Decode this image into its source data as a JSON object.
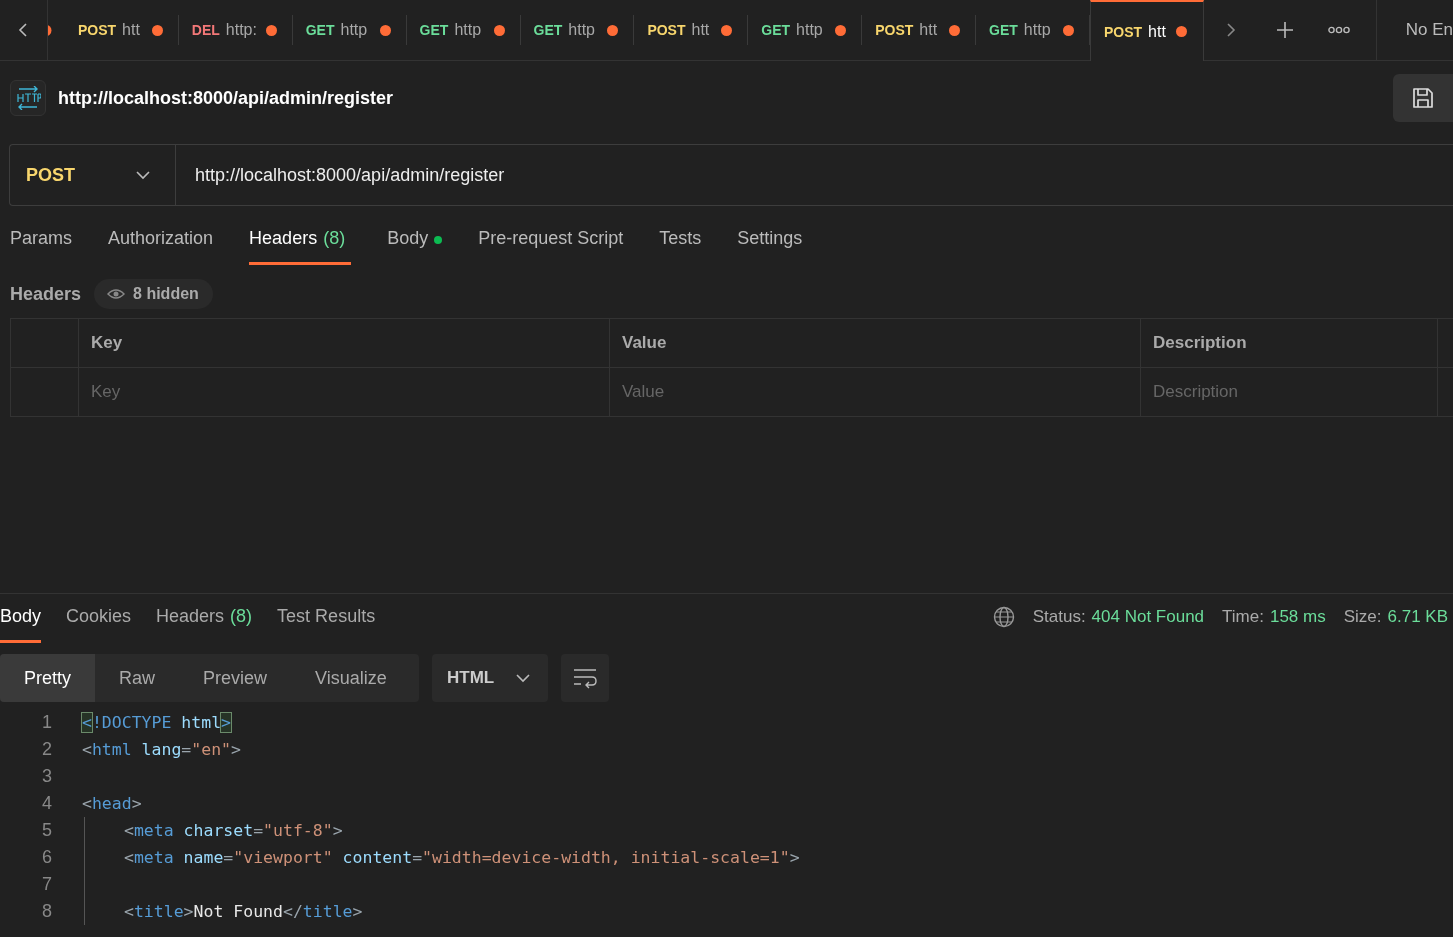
{
  "tabs": [
    {
      "method": "POST",
      "color": "#f8d66d",
      "url": "htt",
      "unsaved": true,
      "selected": false
    },
    {
      "method": "DEL",
      "color": "#f37878",
      "url": "http:",
      "unsaved": true,
      "selected": false
    },
    {
      "method": "GET",
      "color": "#6bdd9a",
      "url": "http",
      "unsaved": true,
      "selected": false
    },
    {
      "method": "GET",
      "color": "#6bdd9a",
      "url": "http",
      "unsaved": true,
      "selected": false
    },
    {
      "method": "GET",
      "color": "#6bdd9a",
      "url": "http",
      "unsaved": true,
      "selected": false
    },
    {
      "method": "POST",
      "color": "#f8d66d",
      "url": "htt",
      "unsaved": true,
      "selected": false
    },
    {
      "method": "GET",
      "color": "#6bdd9a",
      "url": "http",
      "unsaved": true,
      "selected": false
    },
    {
      "method": "POST",
      "color": "#f8d66d",
      "url": "htt",
      "unsaved": true,
      "selected": false
    },
    {
      "method": "GET",
      "color": "#6bdd9a",
      "url": "http",
      "unsaved": true,
      "selected": false
    },
    {
      "method": "POST",
      "color": "#f8d66d",
      "url": "htt",
      "unsaved": true,
      "selected": true
    }
  ],
  "environment": "No En",
  "request": {
    "title": "http://localhost:8000/api/admin/register",
    "method": "POST",
    "url": "http://localhost:8000/api/admin/register",
    "tabs": [
      {
        "label": "Params",
        "selected": false
      },
      {
        "label": "Authorization",
        "selected": false
      },
      {
        "label": "Headers",
        "count": "(8)",
        "selected": true
      },
      {
        "label": "Body",
        "has_content": true,
        "selected": false
      },
      {
        "label": "Pre-request Script",
        "selected": false
      },
      {
        "label": "Tests",
        "selected": false
      },
      {
        "label": "Settings",
        "selected": false
      }
    ],
    "headers_label": "Headers",
    "hidden_label": "8 hidden",
    "table": {
      "columns": [
        "Key",
        "Value",
        "Description"
      ],
      "placeholders": [
        "Key",
        "Value",
        "Description"
      ]
    }
  },
  "response": {
    "tabs": [
      {
        "label": "Body",
        "selected": true
      },
      {
        "label": "Cookies",
        "selected": false
      },
      {
        "label": "Headers",
        "count": "(8)",
        "selected": false
      },
      {
        "label": "Test Results",
        "selected": false
      }
    ],
    "status": [
      {
        "label": "Status:",
        "value": "404 Not Found"
      },
      {
        "label": "Time:",
        "value": "158 ms"
      },
      {
        "label": "Size:",
        "value": "6.71 KB"
      }
    ],
    "views": [
      {
        "label": "Pretty",
        "selected": true
      },
      {
        "label": "Raw",
        "selected": false
      },
      {
        "label": "Preview",
        "selected": false
      },
      {
        "label": "Visualize",
        "selected": false
      }
    ],
    "format": "HTML",
    "code": [
      {
        "number": "1",
        "tokens": [
          {
            "kind": "match",
            "text": "<"
          },
          {
            "kind": "tag",
            "text": "!DOCTYPE"
          },
          {
            "kind": "attr",
            "text": " html"
          },
          {
            "kind": "match",
            "text": ">"
          }
        ]
      },
      {
        "number": "2",
        "tokens": [
          {
            "kind": "punct",
            "text": "<"
          },
          {
            "kind": "tag",
            "text": "html"
          },
          {
            "kind": "attr",
            "text": " lang"
          },
          {
            "kind": "punct",
            "text": "="
          },
          {
            "kind": "str",
            "text": "\"en\""
          },
          {
            "kind": "punct",
            "text": ">"
          }
        ]
      },
      {
        "number": "3"
      },
      {
        "number": "4",
        "tokens": [
          {
            "kind": "punct",
            "text": "<"
          },
          {
            "kind": "tag",
            "text": "head"
          },
          {
            "kind": "punct",
            "text": ">"
          }
        ]
      },
      {
        "number": "5",
        "indent": true,
        "tokens": [
          {
            "kind": "punct",
            "text": "<"
          },
          {
            "kind": "tag",
            "text": "meta"
          },
          {
            "kind": "attr",
            "text": " charset"
          },
          {
            "kind": "punct",
            "text": "="
          },
          {
            "kind": "str",
            "text": "\"utf-8\""
          },
          {
            "kind": "punct",
            "text": ">"
          }
        ]
      },
      {
        "number": "6",
        "indent": true,
        "tokens": [
          {
            "kind": "punct",
            "text": "<"
          },
          {
            "kind": "tag",
            "text": "meta"
          },
          {
            "kind": "attr",
            "text": " name"
          },
          {
            "kind": "punct",
            "text": "="
          },
          {
            "kind": "str",
            "text": "\"viewport\""
          },
          {
            "kind": "attr",
            "text": " content"
          },
          {
            "kind": "punct",
            "text": "="
          },
          {
            "kind": "str",
            "text": "\"width=device-width, initial-scale=1\""
          },
          {
            "kind": "punct",
            "text": ">"
          }
        ]
      },
      {
        "number": "7",
        "indent": true
      },
      {
        "number": "8",
        "indent": true,
        "tokens": [
          {
            "kind": "punct",
            "text": "<"
          },
          {
            "kind": "tag",
            "text": "title"
          },
          {
            "kind": "punct",
            "text": ">"
          },
          {
            "kind": "text",
            "text": "Not Found"
          },
          {
            "kind": "punct",
            "text": "</"
          },
          {
            "kind": "tag",
            "text": "title"
          },
          {
            "kind": "punct",
            "text": ">"
          }
        ]
      }
    ]
  }
}
